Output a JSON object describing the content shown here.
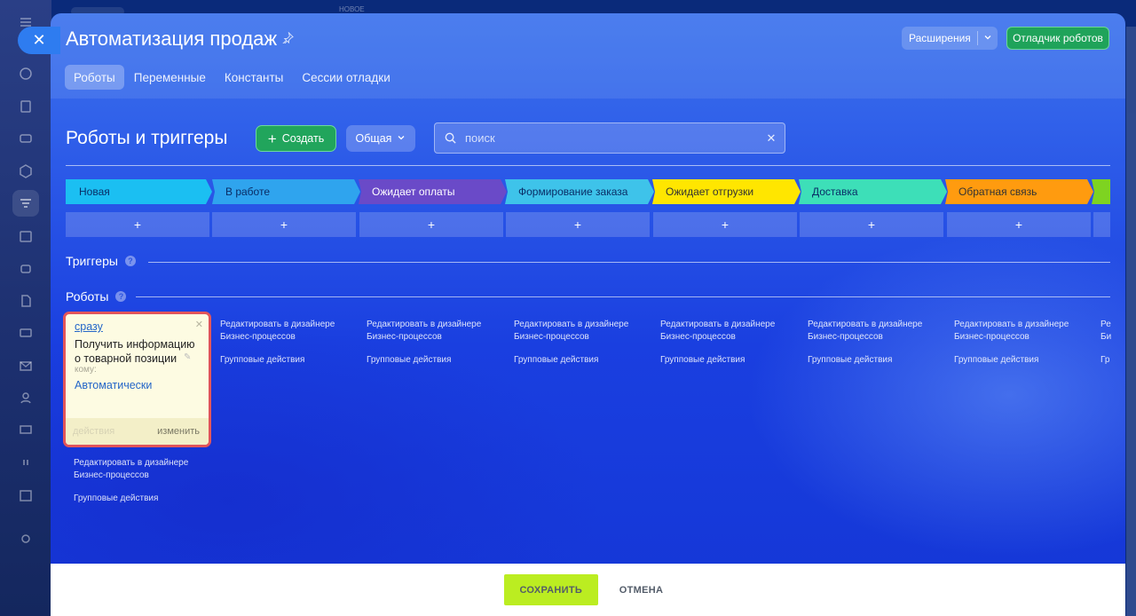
{
  "background": {
    "tab_hint": "НОВОЕ"
  },
  "window": {
    "title": "Автоматизация продаж",
    "extensions_label": "Расширения",
    "debugger_label": "Отладчик роботов",
    "tabs": [
      {
        "label": "Роботы",
        "active": true
      },
      {
        "label": "Переменные",
        "active": false
      },
      {
        "label": "Константы",
        "active": false
      },
      {
        "label": "Сессии отладки",
        "active": false
      }
    ]
  },
  "toolbar": {
    "section_title": "Роботы и триггеры",
    "create_label": "Создать",
    "general_label": "Общая",
    "search_placeholder": "поиск"
  },
  "stages": [
    {
      "label": "Новая",
      "color": "#1bbff2",
      "text_color": "#0a2d66"
    },
    {
      "label": "В работе",
      "color": "#2fa4ee",
      "text_color": "#0a2d66"
    },
    {
      "label": "Ожидает оплаты",
      "color": "#6a4ac8",
      "text_color": "#ffffff"
    },
    {
      "label": "Формирование заказа",
      "color": "#3ec3ea",
      "text_color": "#0a2d66"
    },
    {
      "label": "Ожидает отгрузки",
      "color": "#ffe600",
      "text_color": "#333333"
    },
    {
      "label": "Доставка",
      "color": "#3ddfb8",
      "text_color": "#0a2d66"
    },
    {
      "label": "Обратная связь",
      "color": "#ff9b0f",
      "text_color": "#333333"
    },
    {
      "label": "",
      "color": "#7ed321",
      "text_color": "#333333"
    }
  ],
  "add_label": "+",
  "triggers_label": "Триггеры",
  "robots_label": "Роботы",
  "robot_card": {
    "when": "сразу",
    "title": "Получить информацию о товарной позиции",
    "to_label": "кому:",
    "to_value": "Автоматически",
    "actions_label": "действия",
    "change_label": "изменить"
  },
  "column_links": {
    "edit_designer": "Редактировать в дизайнере Бизнес-процессов",
    "group_actions": "Групповые действия"
  },
  "partial_links": {
    "edit_designer": "Ре Би",
    "group_actions": "Гр"
  },
  "footer": {
    "save_label": "СОХРАНИТЬ",
    "cancel_label": "ОТМЕНА"
  }
}
